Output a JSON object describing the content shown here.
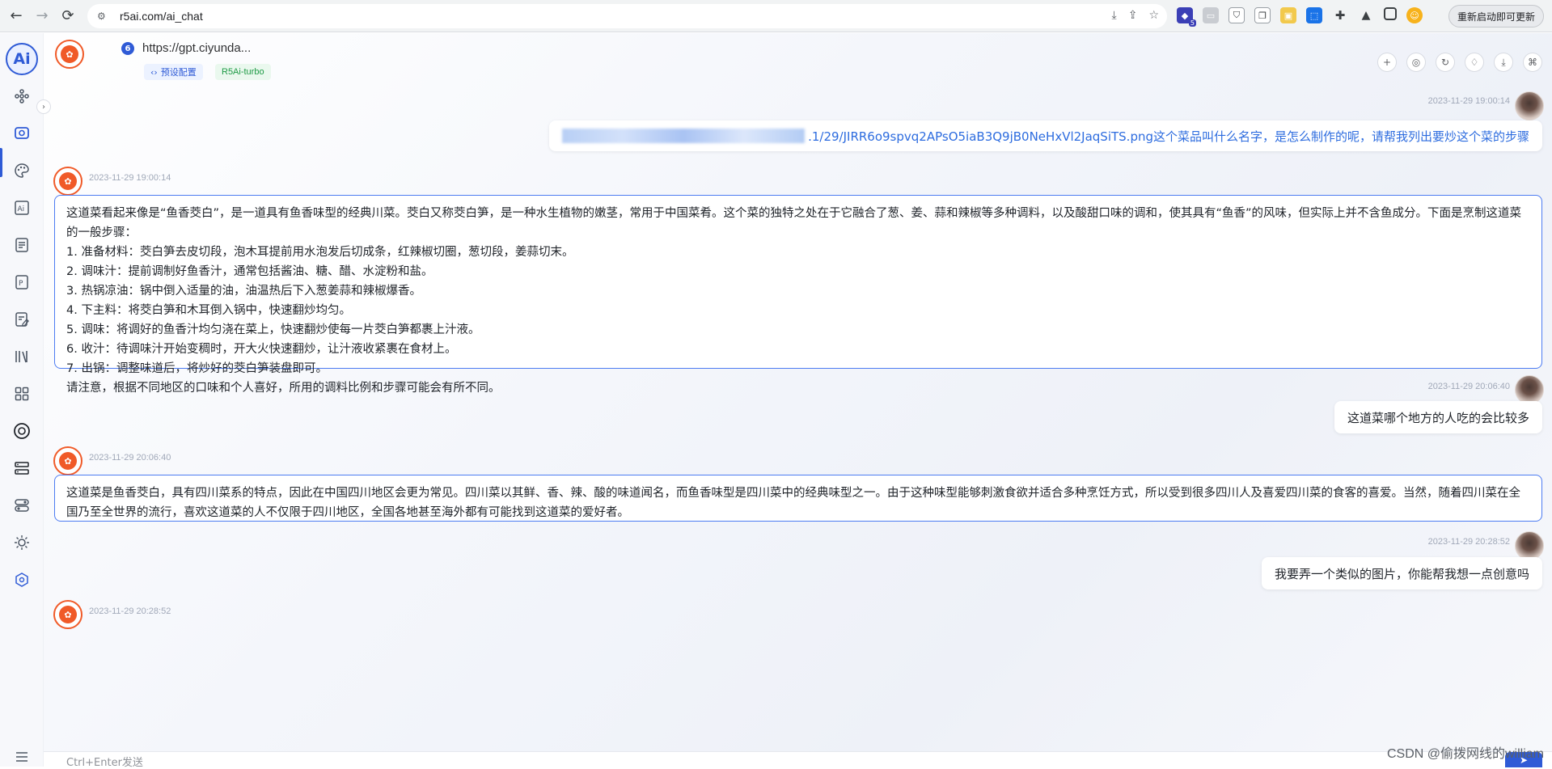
{
  "browser": {
    "url": "r5ai.com/ai_chat",
    "restart_label": "重新启动即可更新",
    "extension_badge": "5"
  },
  "chat": {
    "title": "https://gpt.ciyunda...",
    "badge_count": "6",
    "preset_tag": "预设配置",
    "model_tag": "R5Ai-turbo"
  },
  "messages": [
    {
      "role": "user",
      "time": "2023-11-29 19:00:14",
      "text": ".1/29/JIRR6o9spvq2APsO5iaB3Q9jB0NeHxVl2JaqSiTS.png这个菜品叫什么名字，是怎么制作的呢，请帮我列出要炒这个菜的步骤"
    },
    {
      "role": "bot",
      "time": "2023-11-29 19:00:14",
      "lines": [
        "这道菜看起来像是“鱼香茭白”，是一道具有鱼香味型的经典川菜。茭白又称茭白笋，是一种水生植物的嫩茎，常用于中国菜肴。这个菜的独特之处在于它融合了葱、姜、蒜和辣椒等多种调料，以及酸甜口味的调和，使其具有“鱼香”的风味，但实际上并不含鱼成分。下面是烹制这道菜的一般步骤：",
        "1. 准备材料：茭白笋去皮切段，泡木耳提前用水泡发后切成条，红辣椒切圈，葱切段，姜蒜切末。",
        "2. 调味汁：提前调制好鱼香汁，通常包括酱油、糖、醋、水淀粉和盐。",
        "3. 热锅凉油：锅中倒入适量的油，油温热后下入葱姜蒜和辣椒爆香。",
        "4. 下主料：将茭白笋和木耳倒入锅中，快速翻炒均匀。",
        "5. 调味：将调好的鱼香汁均匀浇在菜上，快速翻炒使每一片茭白笋都裹上汁液。",
        "6. 收汁：待调味汁开始变稠时，开大火快速翻炒，让汁液收紧裹在食材上。",
        "7. 出锅：调整味道后，将炒好的茭白笋装盘即可。",
        "请注意，根据不同地区的口味和个人喜好，所用的调料比例和步骤可能会有所不同。"
      ]
    },
    {
      "role": "user",
      "time": "2023-11-29 20:06:40",
      "text": "这道菜哪个地方的人吃的会比较多"
    },
    {
      "role": "bot",
      "time": "2023-11-29 20:06:40",
      "lines": [
        "这道菜是鱼香茭白，具有四川菜系的特点，因此在中国四川地区会更为常见。四川菜以其鲜、香、辣、酸的味道闻名，而鱼香味型是四川菜中的经典味型之一。由于这种味型能够刺激食欲并适合多种烹饪方式，所以受到很多四川人及喜爱四川菜的食客的喜爱。当然，随着四川菜在全国乃至全世界的流行，喜欢这道菜的人不仅限于四川地区，全国各地甚至海外都有可能找到这道菜的爱好者。"
      ]
    },
    {
      "role": "user",
      "time": "2023-11-29 20:28:52",
      "text": "我要弄一个类似的图片，你能帮我想一点创意吗"
    },
    {
      "role": "bot",
      "time": "2023-11-29 20:28:52"
    }
  ],
  "input": {
    "placeholder": "Ctrl+Enter发送"
  },
  "watermark": "CSDN @偷拨网线的william"
}
